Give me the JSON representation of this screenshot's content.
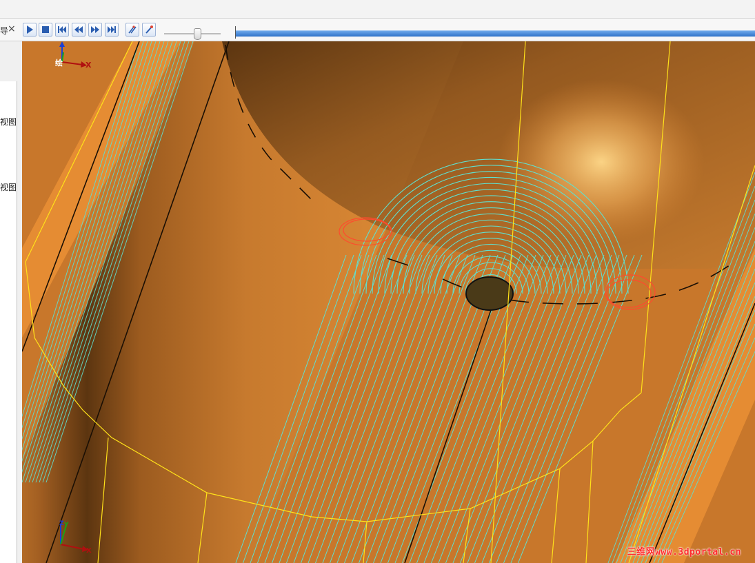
{
  "panel": {
    "header_glyph": "导",
    "close_glyph": "×",
    "left_labels": [
      "视图",
      "视图"
    ]
  },
  "playback": {
    "buttons": [
      {
        "name": "play-button",
        "icon": "play-icon"
      },
      {
        "name": "stop-button",
        "icon": "stop-icon"
      },
      {
        "name": "skip-to-start-button",
        "icon": "skip-start-icon"
      },
      {
        "name": "step-back-button",
        "icon": "step-back-icon"
      },
      {
        "name": "step-forward-button",
        "icon": "step-forward-icon"
      },
      {
        "name": "skip-to-end-button",
        "icon": "skip-end-icon"
      },
      {
        "name": "toolpath-display-toggle",
        "icon": "toolpath-icon"
      },
      {
        "name": "tool-display-toggle",
        "icon": "tool-icon"
      }
    ],
    "speed_fraction": 0.55,
    "progress_fraction": 1.0
  },
  "viewport": {
    "triad_top": {
      "x": "X",
      "y": "Y",
      "label": "绘"
    },
    "triad_bottom": {
      "x": "X",
      "y": "Y",
      "z": "Z"
    },
    "watermark": "三维网www.3dportal.cn",
    "colors": {
      "surface": "#c9782a",
      "toolpath": "#5fe0cf",
      "boundary": "#ffe21a",
      "tool": "#ff4a2e"
    }
  }
}
